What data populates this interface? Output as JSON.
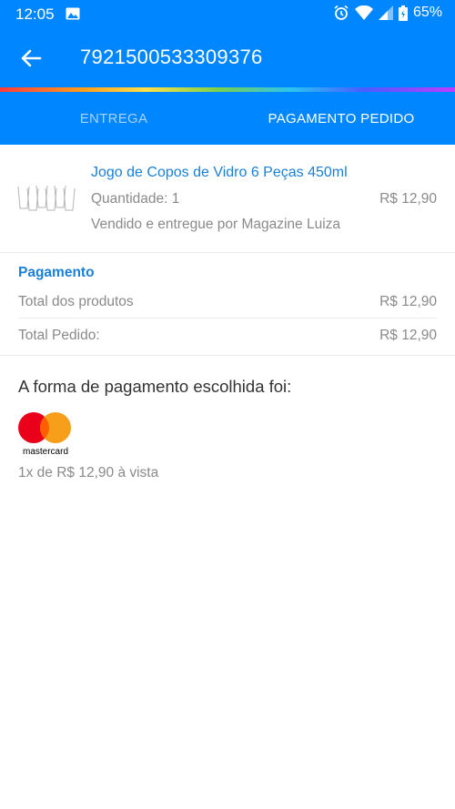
{
  "status_bar": {
    "time": "12:05",
    "battery": "65%"
  },
  "header": {
    "order_number": "7921500533309376"
  },
  "tabs": [
    {
      "label": "ENTREGA",
      "active": false
    },
    {
      "label": "PAGAMENTO PEDIDO",
      "active": true
    }
  ],
  "product": {
    "name": "Jogo de Copos de Vidro 6 Peças 450ml",
    "quantity": "Quantidade: 1",
    "price": "R$ 12,90",
    "seller": "Vendido e entregue por Magazine Luiza"
  },
  "payment": {
    "title": "Pagamento",
    "rows": [
      {
        "label": "Total dos produtos",
        "value": "R$ 12,90"
      },
      {
        "label": "Total Pedido:",
        "value": "R$ 12,90"
      }
    ]
  },
  "payment_method": {
    "label": "A forma de pagamento escolhida foi:",
    "brand": "mastercard",
    "installments": "1x de R$ 12,90 à vista"
  },
  "colors": {
    "primary": "#0086ff",
    "link": "#1a7fd6",
    "muted": "#8a8a8a"
  }
}
